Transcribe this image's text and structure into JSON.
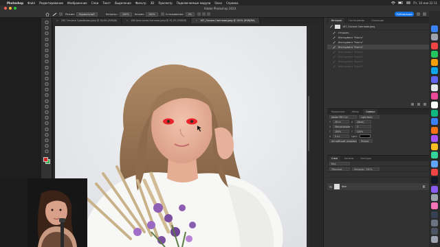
{
  "menubar": {
    "app_name": "Photoshop",
    "items": [
      "Файл",
      "Редактирование",
      "Изображение",
      "Слои",
      "Текст",
      "Выделение",
      "Фильтр",
      "3D",
      "Просмотр",
      "Подключаемые модули",
      "Окно",
      "Справка"
    ],
    "clock": "Пт, 16 мая 22:11"
  },
  "window": {
    "title": "Adobe Photoshop 2023"
  },
  "options": {
    "mode_label": "Режим:",
    "mode_value": "Нормальный",
    "opacity_label": "Непрозр.:",
    "opacity_value": "100%",
    "flow_label": "Нажим:",
    "flow_value": "100%",
    "smooth_label": "Сглаживание:",
    "smooth_value": "0%",
    "publish_label": "Публикация"
  },
  "tabs": [
    {
      "label": "185 Татьяна Сдвийкова.jpeg @ 16,6% (RGB/8)",
      "active": false
    },
    {
      "label": "186 Анастасия Котлова.jpeg @ 33,3% (RGB/8)",
      "active": false
    },
    {
      "label": "187_Оксана Светлова.jpeg @ 100% (RGB/8#)",
      "active": true
    }
  ],
  "history": {
    "tabs": [
      "История",
      "Гистограмма",
      "Операции"
    ],
    "snapshot": "187_Оксана Светлова.jpeg",
    "items": [
      {
        "label": "Открыть",
        "state": "normal"
      },
      {
        "label": "Инструмент \"Кисть\"",
        "state": "normal"
      },
      {
        "label": "Инструмент \"Кисть\"",
        "state": "normal"
      },
      {
        "label": "Инструмент \"Кисть\"",
        "state": "current"
      },
      {
        "label": "Инструмент \"Кисть\"",
        "state": "dim"
      },
      {
        "label": "Инструмент \"Кисть\"",
        "state": "dim"
      },
      {
        "label": "Инструмент \"Кисть\"",
        "state": "dim"
      },
      {
        "label": "Инструмент \"Кисть\"",
        "state": "dim"
      }
    ]
  },
  "properties": {
    "tabs": [
      "Коррекция",
      "Абзац",
      "Символ"
    ],
    "font": "Adobe PRO Cyr",
    "style": "Light Italic",
    "size": "26 пт",
    "leading": "(Авто)",
    "tracking": "Метрические",
    "kerning": "0",
    "scale_v": "100%",
    "scale_h": "100%",
    "baseline": "0 пт",
    "color_label": "Цвет:",
    "lang": "Английский: Америка",
    "aa": "Резкое"
  },
  "layers": {
    "tabs": [
      "Слои",
      "Каналы",
      "Контуры"
    ],
    "search": "Вид",
    "blend": "Обычные",
    "opacity": "Непрозр.: 100%",
    "layer_name": "Фон"
  },
  "colors": {
    "accent": "#1473e6",
    "foreground": "#d62828",
    "background": "#33b24a"
  }
}
